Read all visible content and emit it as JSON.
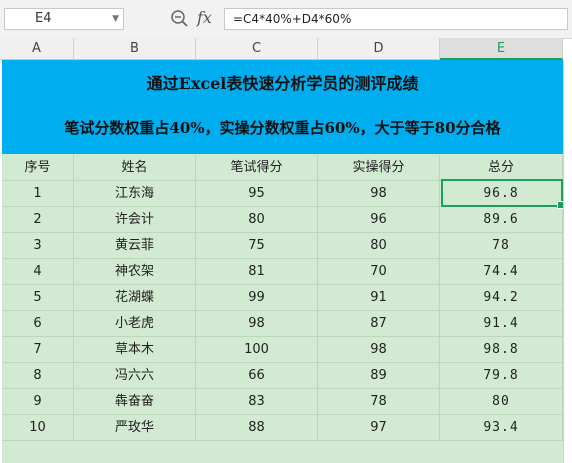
{
  "formula_bar": {
    "cell_ref": "E4",
    "fx_label": "fx",
    "formula": "=C4*40%+D4*60%"
  },
  "columns": [
    "A",
    "B",
    "C",
    "D",
    "E"
  ],
  "selected_column": "E",
  "title": {
    "line1": "通过Excel表快速分析学员的测评成绩",
    "line2": "笔试分数权重占40%，实操分数权重占60%，大于等于80分合格"
  },
  "table": {
    "headers": [
      "序号",
      "姓名",
      "笔试得分",
      "实操得分",
      "总分"
    ],
    "rows": [
      [
        "1",
        "江东海",
        "95",
        "98",
        "96.8"
      ],
      [
        "2",
        "许会计",
        "80",
        "96",
        "89.6"
      ],
      [
        "3",
        "黄云菲",
        "75",
        "80",
        "78"
      ],
      [
        "4",
        "神农架",
        "81",
        "70",
        "74.4"
      ],
      [
        "5",
        "花湖蝶",
        "99",
        "91",
        "94.2"
      ],
      [
        "6",
        "小老虎",
        "98",
        "87",
        "91.4"
      ],
      [
        "7",
        "草本木",
        "100",
        "98",
        "98.8"
      ],
      [
        "8",
        "冯六六",
        "66",
        "89",
        "79.8"
      ],
      [
        "9",
        "犇奋奋",
        "83",
        "78",
        "80"
      ],
      [
        "10",
        "严玫华",
        "88",
        "97",
        "93.4"
      ]
    ]
  },
  "colors": {
    "banner": "#00adee",
    "body": "#d2ead1",
    "selection": "#1aa05b"
  }
}
